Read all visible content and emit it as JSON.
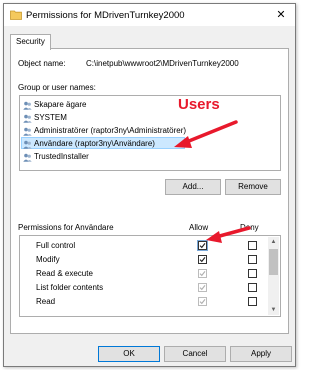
{
  "window": {
    "title": "Permissions for MDrivenTurnkey2000",
    "close_glyph": "✕"
  },
  "tabs": [
    {
      "label": "Security"
    }
  ],
  "object": {
    "label": "Object name:",
    "value": "C:\\inetpub\\wwwroot2\\MDrivenTurnkey2000"
  },
  "groups": {
    "label": "Group or user names:",
    "items": [
      {
        "label": "Skapare ägare",
        "selected": false
      },
      {
        "label": "SYSTEM",
        "selected": false
      },
      {
        "label": "Administratörer (raptor3ny\\Administratörer)",
        "selected": false
      },
      {
        "label": "Användare (raptor3ny\\Användare)",
        "selected": true
      },
      {
        "label": "TrustedInstaller",
        "selected": false
      }
    ],
    "add_label": "Add...",
    "remove_label": "Remove"
  },
  "permissions": {
    "label": "Permissions for Användare",
    "allow_header": "Allow",
    "deny_header": "Deny",
    "rows": [
      {
        "label": "Full control",
        "allow": true,
        "allow_enabled": true,
        "deny": false
      },
      {
        "label": "Modify",
        "allow": true,
        "allow_enabled": true,
        "deny": false
      },
      {
        "label": "Read & execute",
        "allow": true,
        "allow_enabled": false,
        "deny": false
      },
      {
        "label": "List folder contents",
        "allow": true,
        "allow_enabled": false,
        "deny": false
      },
      {
        "label": "Read",
        "allow": true,
        "allow_enabled": false,
        "deny": false
      }
    ]
  },
  "buttons": {
    "ok": "OK",
    "cancel": "Cancel",
    "apply": "Apply"
  },
  "annotations": {
    "users_label": "Users",
    "arrow_color": "#e8192c"
  },
  "colors": {
    "selection_bg": "#cce8ff",
    "accent": "#0078d7"
  }
}
